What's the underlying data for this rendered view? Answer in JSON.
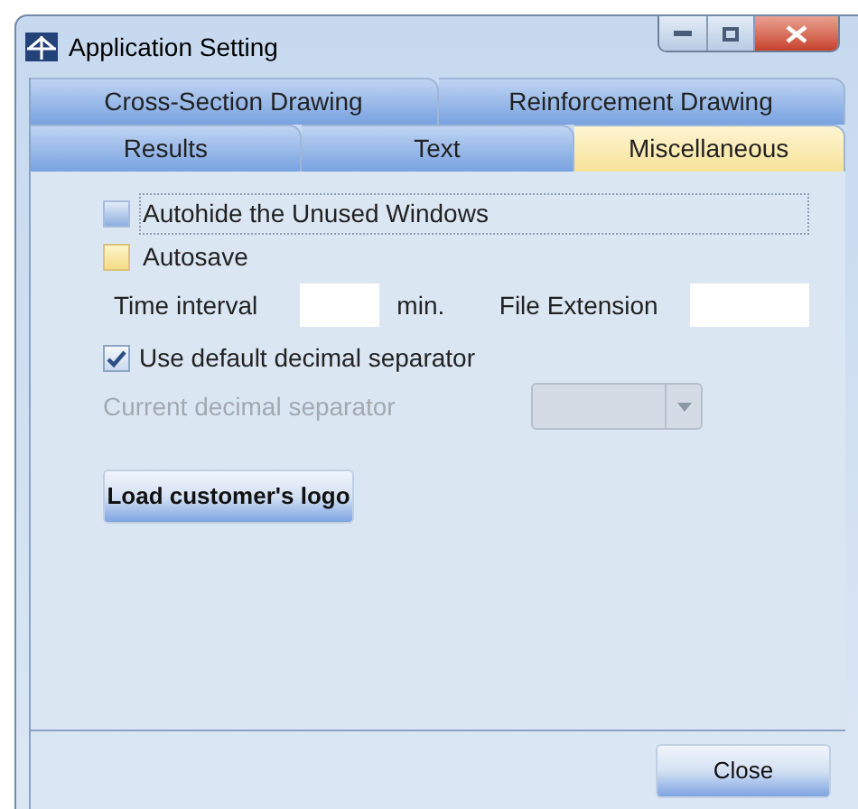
{
  "window": {
    "title": "Application Setting"
  },
  "tab_rows": [
    [
      {
        "label": "Cross-Section Drawing",
        "selected": false
      },
      {
        "label": "Reinforcement Drawing",
        "selected": false
      }
    ],
    [
      {
        "label": "Results",
        "selected": false
      },
      {
        "label": "Text",
        "selected": false
      },
      {
        "label": "Miscellaneous",
        "selected": true
      }
    ]
  ],
  "options": [
    {
      "label": "Autohide the Unused Windows",
      "checked": false,
      "focused": true,
      "hovered": false
    },
    {
      "label": "Autosave",
      "checked": false,
      "focused": false,
      "hovered": true
    }
  ],
  "autosave_fields": {
    "time_label": "Time interval",
    "unit": "min.",
    "extension_label": "File Extension"
  },
  "decimal": {
    "label": "Use default decimal separator",
    "checked": true,
    "current_label": "Current decimal separator",
    "disabled": true
  },
  "logo_button": "Load customer's logo",
  "close_button": "Close"
}
